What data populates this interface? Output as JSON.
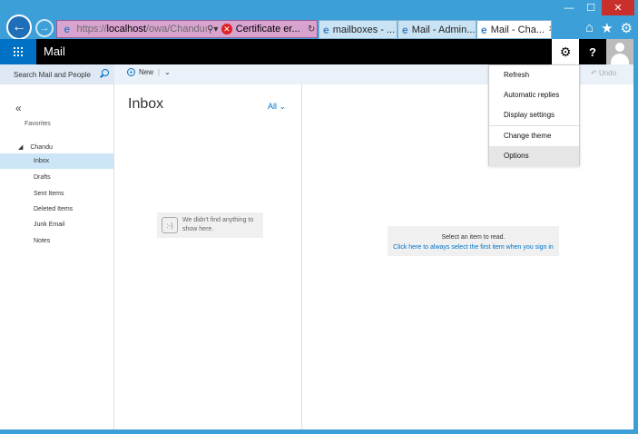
{
  "browser": {
    "url_prefix": "https://",
    "url_host": "localhost",
    "url_path": "/owa/Chandu@n",
    "certificate_label": "Certificate er...",
    "tabs": [
      {
        "label": "mailboxes - ..."
      },
      {
        "label": "Mail - Admin..."
      },
      {
        "label": "Mail - Cha..."
      }
    ]
  },
  "app": {
    "title": "Mail"
  },
  "command_bar": {
    "search_placeholder": "Search Mail and People",
    "new_label": "New",
    "undo_label": "Undo"
  },
  "left_nav": {
    "favorites_label": "Favorites",
    "account_label": "Chandu",
    "items": [
      {
        "label": "Inbox"
      },
      {
        "label": "Drafts"
      },
      {
        "label": "Sent Items"
      },
      {
        "label": "Deleted Items"
      },
      {
        "label": "Junk Email"
      },
      {
        "label": "Notes"
      }
    ]
  },
  "message_list": {
    "title": "Inbox",
    "filter_label": "All",
    "empty_face": ":-)",
    "empty_text_line1": "We didn't find anything to",
    "empty_text_line2": "show here."
  },
  "reading_pane": {
    "prompt": "Select an item to read.",
    "link": "Click here to always select the first item when you sign in"
  },
  "settings_menu": {
    "items": [
      {
        "label": "Refresh"
      },
      {
        "label": "Automatic replies"
      },
      {
        "label": "Display settings"
      },
      {
        "label": "Change theme"
      },
      {
        "label": "Options"
      }
    ]
  },
  "colors": {
    "accent": "#0072c6",
    "chrome": "#3d9fd8",
    "appbar": "#000000"
  }
}
